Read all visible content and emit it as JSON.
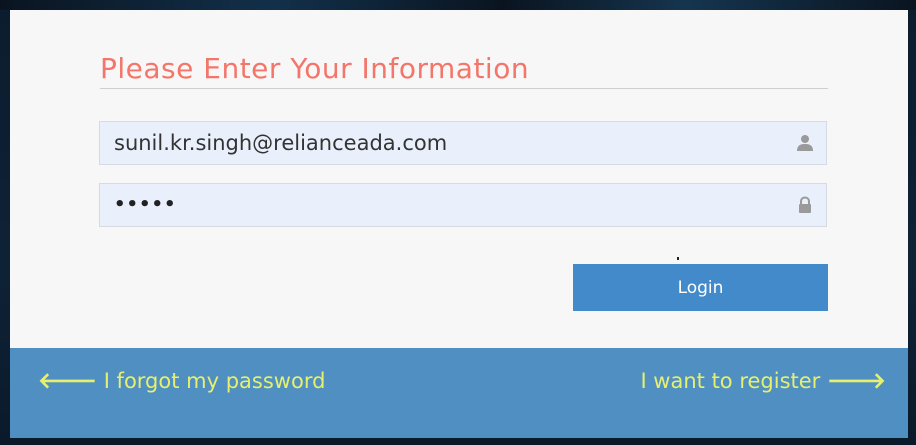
{
  "form": {
    "heading": "Please Enter Your Information",
    "email": {
      "value": "sunil.kr.singh@relianceada.com",
      "icon": "user-icon"
    },
    "password": {
      "masked_value": "•••••",
      "icon": "lock-icon"
    },
    "login_label": "Login"
  },
  "footer": {
    "forgot_label": "I forgot my password",
    "forgot_arrow": "🡐",
    "register_label": "I want to register",
    "register_arrow": "🡒"
  },
  "colors": {
    "heading": "#f4766a",
    "button": "#438acb",
    "footer_bg": "#4f8fc2",
    "footer_link": "#e6f06e",
    "field_bg": "#e9f0fb"
  }
}
